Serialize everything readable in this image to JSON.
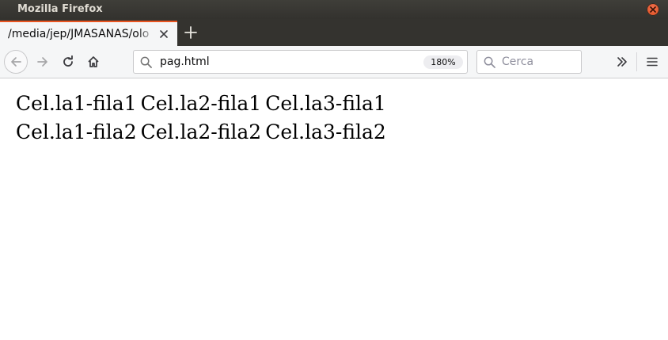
{
  "window": {
    "title": "Mozilla Firefox"
  },
  "tabs": [
    {
      "label": "/media/jep/JMASANAS/olo",
      "active": true
    }
  ],
  "toolbar": {
    "url": "pag.html",
    "zoom": "180%",
    "search_placeholder": "Cerca"
  },
  "icons": {
    "close_window": "close-icon",
    "tab_close": "close-icon",
    "new_tab": "plus-icon",
    "back": "back-arrow-icon",
    "forward": "forward-arrow-icon",
    "reload": "reload-icon",
    "home": "home-icon",
    "search": "search-icon",
    "overflow": "double-chevron-icon",
    "menu": "hamburger-icon"
  },
  "colors": {
    "accent": "#e95420",
    "titlebar": "#3b3a36",
    "toolbar": "#f5f6f7"
  },
  "page": {
    "table": {
      "rows": [
        [
          "Cel.la1-fila1",
          "Cel.la2-fila1",
          "Cel.la3-fila1"
        ],
        [
          "Cel.la1-fila2",
          "Cel.la2-fila2",
          "Cel.la3-fila2"
        ]
      ]
    }
  }
}
